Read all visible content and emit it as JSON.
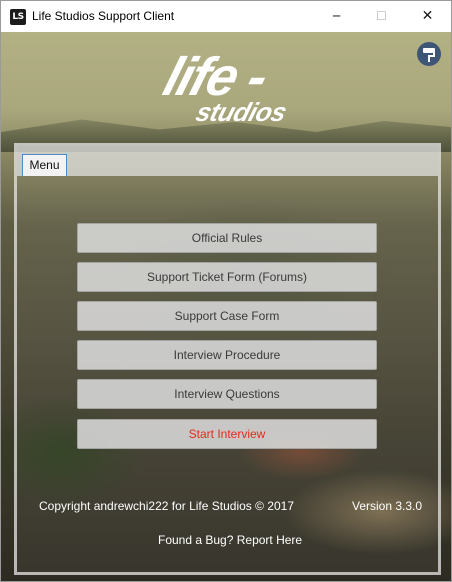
{
  "window": {
    "title": "Life Studios Support Client",
    "icon_text": "LS",
    "minimize_glyph": "─",
    "maximize_glyph": "☐",
    "close_glyph": "✕"
  },
  "logo": {
    "line1": "life -",
    "line2": "studios"
  },
  "header": {
    "icon": "paint-roller-icon"
  },
  "tabs": [
    {
      "label": "Menu",
      "selected": true
    }
  ],
  "menu": {
    "buttons": [
      {
        "label": "Official Rules"
      },
      {
        "label": "Support Ticket Form (Forums)"
      },
      {
        "label": "Support Case Form"
      },
      {
        "label": "Interview Procedure"
      },
      {
        "label": "Interview Questions"
      },
      {
        "label": "Start Interview"
      }
    ]
  },
  "footer": {
    "copyright": "Copyright  andrewchi222  for Life Studios © 2017",
    "version": "Version 3.3.0",
    "bug_link": "Found a Bug?  Report Here"
  },
  "colors": {
    "danger_text": "#e52a1c",
    "tab_border": "#4d8ac5",
    "icon_circle": "#3e5676"
  }
}
